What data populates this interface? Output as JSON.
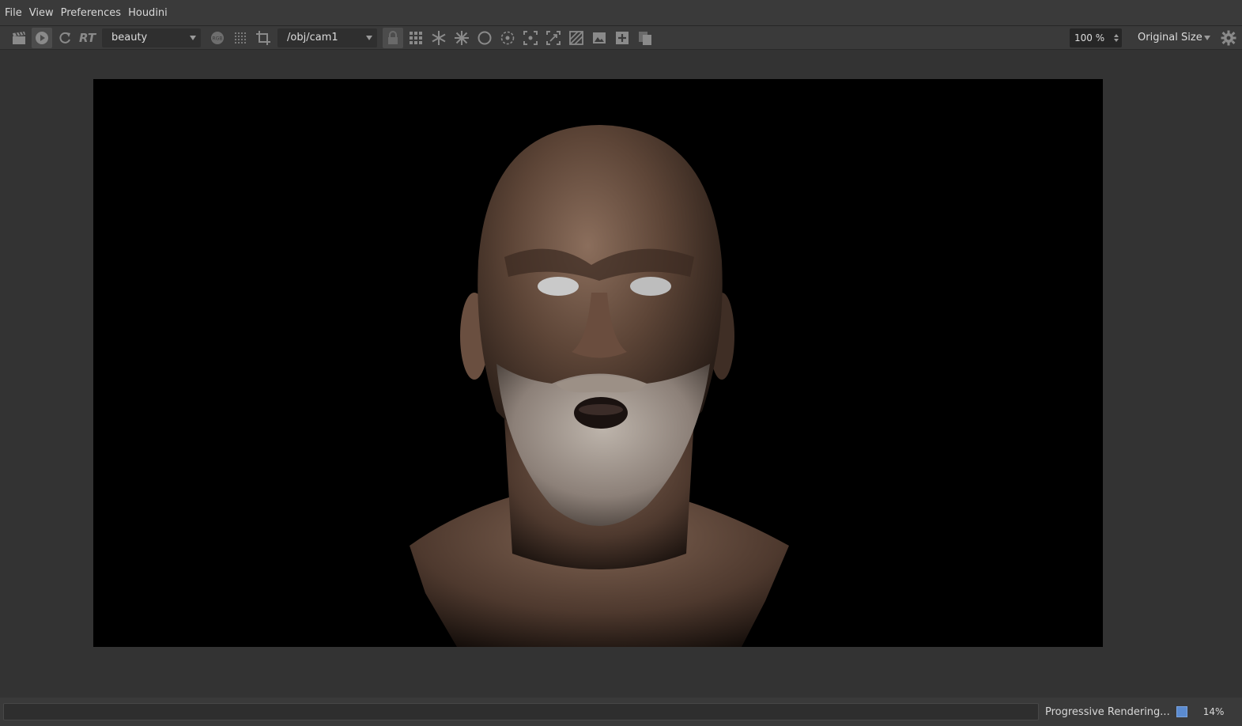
{
  "menubar": {
    "items": [
      "File",
      "View",
      "Preferences",
      "Houdini"
    ]
  },
  "toolbar": {
    "icons": [
      "clapper-icon",
      "render-play-icon",
      "refresh-icon"
    ],
    "rt_label": "RT",
    "aov": {
      "value": "beauty"
    },
    "camera": {
      "value": "/obj/cam1"
    },
    "zoom": {
      "value": "100 %"
    },
    "size_mode": {
      "value": "Original Size"
    }
  },
  "status": {
    "text": "Progressive Rendering...",
    "progress_percent": 14,
    "progress_label": "14%",
    "accent_color": "#5b8bd0"
  }
}
